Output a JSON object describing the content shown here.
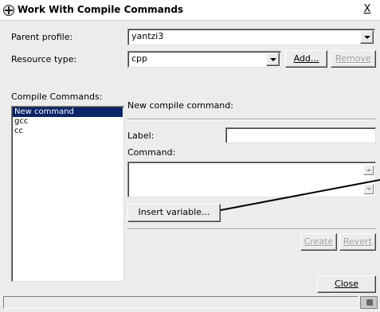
{
  "window": {
    "title": "Work With Compile Commands",
    "close_label": "X"
  },
  "form": {
    "parent_profile_label": "Parent profile:",
    "parent_profile_value": "yantzi3",
    "resource_type_label": "Resource type:",
    "resource_type_value": "cpp",
    "add_button_label": "Add...",
    "remove_button_label": "Remove"
  },
  "commands": {
    "list_label": "Compile Commands:",
    "items": [
      "New command",
      "gcc",
      "cc"
    ],
    "selected_index": 0
  },
  "editor": {
    "heading": "New compile command:",
    "label_label": "Label:",
    "label_value": "",
    "command_label": "Command:",
    "command_value": "",
    "insert_variable_label": "Insert variable...",
    "create_button_label": "Create",
    "revert_button_label": "Revert"
  },
  "footer": {
    "close_button_label": "Close"
  },
  "colors": {
    "selection": "#0a246a",
    "dialog_bg": "#ececec",
    "callout_line": "#000000"
  },
  "icons": {
    "title_icon": "crosshair-globe-icon",
    "dropdown_icon": "chevron-down-icon",
    "grip_icon": "status-grip-icon"
  }
}
